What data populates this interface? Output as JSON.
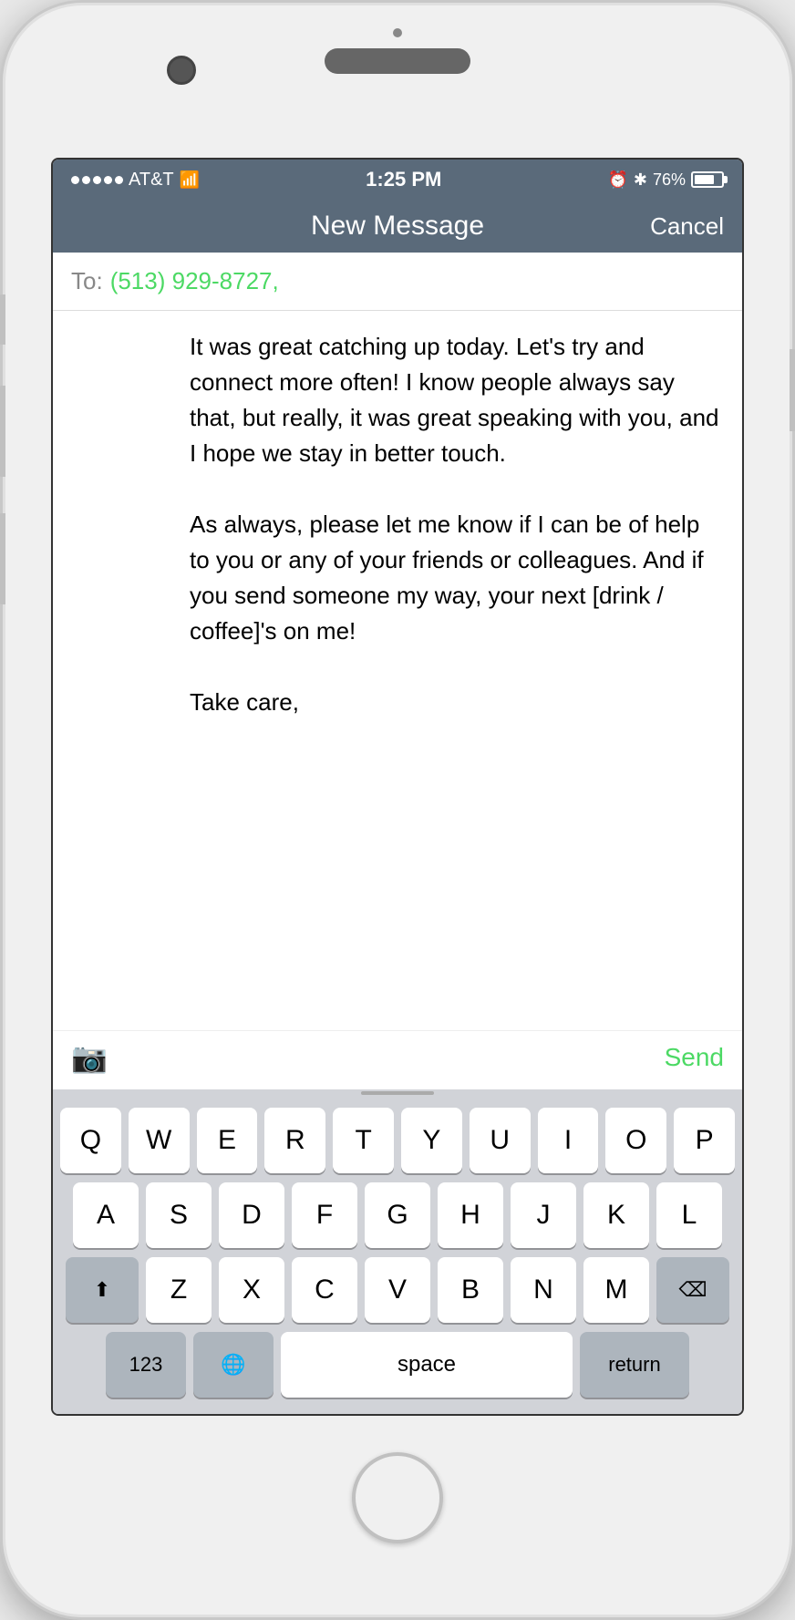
{
  "status_bar": {
    "carrier": "AT&T",
    "time": "1:25 PM",
    "battery_percent": "76%"
  },
  "nav": {
    "title": "New Message",
    "cancel_label": "Cancel"
  },
  "to_field": {
    "label": "To:",
    "recipient": "(513) 929-8727,"
  },
  "message": {
    "body": "It was great catching up today. Let's try and connect more often! I know people always say that, but really, it was great speaking with you, and I hope we stay in better touch.\n\nAs always, please let me know if I can be of help to you or any of your friends or colleagues. And if you send someone my way, your next [drink / coffee]'s on me!\n\nTake care,",
    "send_label": "Send"
  },
  "keyboard": {
    "rows": [
      [
        "Q",
        "W",
        "E",
        "R",
        "T",
        "Y",
        "U",
        "I",
        "O",
        "P"
      ],
      [
        "A",
        "S",
        "D",
        "F",
        "G",
        "H",
        "J",
        "K",
        "L"
      ],
      [
        "⬆",
        "Z",
        "X",
        "C",
        "V",
        "B",
        "N",
        "M",
        "⌫"
      ],
      [
        "123",
        "🌐",
        "space",
        "return"
      ]
    ],
    "space_label": "space",
    "return_label": "return",
    "numbers_label": "123"
  }
}
